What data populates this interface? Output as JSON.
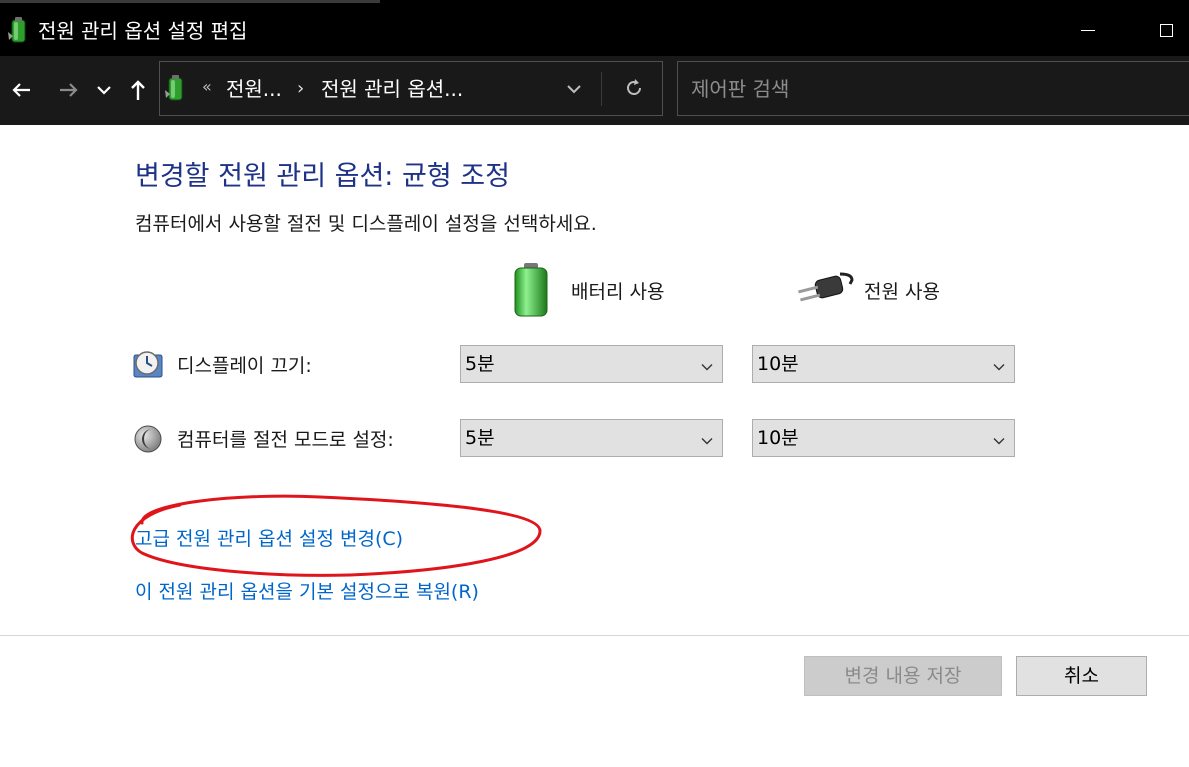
{
  "window": {
    "title": "전원 관리 옵션 설정 편집"
  },
  "nav": {
    "breadcrumb_overflow": "«",
    "crumbs": [
      "전원...",
      "전원 관리 옵션..."
    ],
    "crumb_separator": "›",
    "search_placeholder": "제어판 검색"
  },
  "main": {
    "heading": "변경할 전원 관리 옵션: 균형 조정",
    "subtitle": "컴퓨터에서 사용할 절전 및 디스플레이 설정을 선택하세요.",
    "columns": {
      "battery": "배터리 사용",
      "plugged_in": "전원 사용"
    },
    "rows": [
      {
        "label": "디스플레이 끄기:",
        "battery_value": "5분",
        "plugged_value": "10분",
        "icon": "display-timer-icon"
      },
      {
        "label": "컴퓨터를 절전 모드로 설정:",
        "battery_value": "5분",
        "plugged_value": "10분",
        "icon": "sleep-moon-icon"
      }
    ],
    "links": {
      "advanced": "고급 전원 관리 옵션 설정 변경(C)",
      "restore": "이 전원 관리 옵션을 기본 설정으로 복원(R)"
    }
  },
  "footer": {
    "save_label": "변경 내용 저장",
    "cancel_label": "취소"
  },
  "colors": {
    "heading": "#1e3287",
    "link": "#0066cc",
    "annotation": "#e0151c",
    "titlebar": "#000000",
    "navbar": "#191919"
  }
}
